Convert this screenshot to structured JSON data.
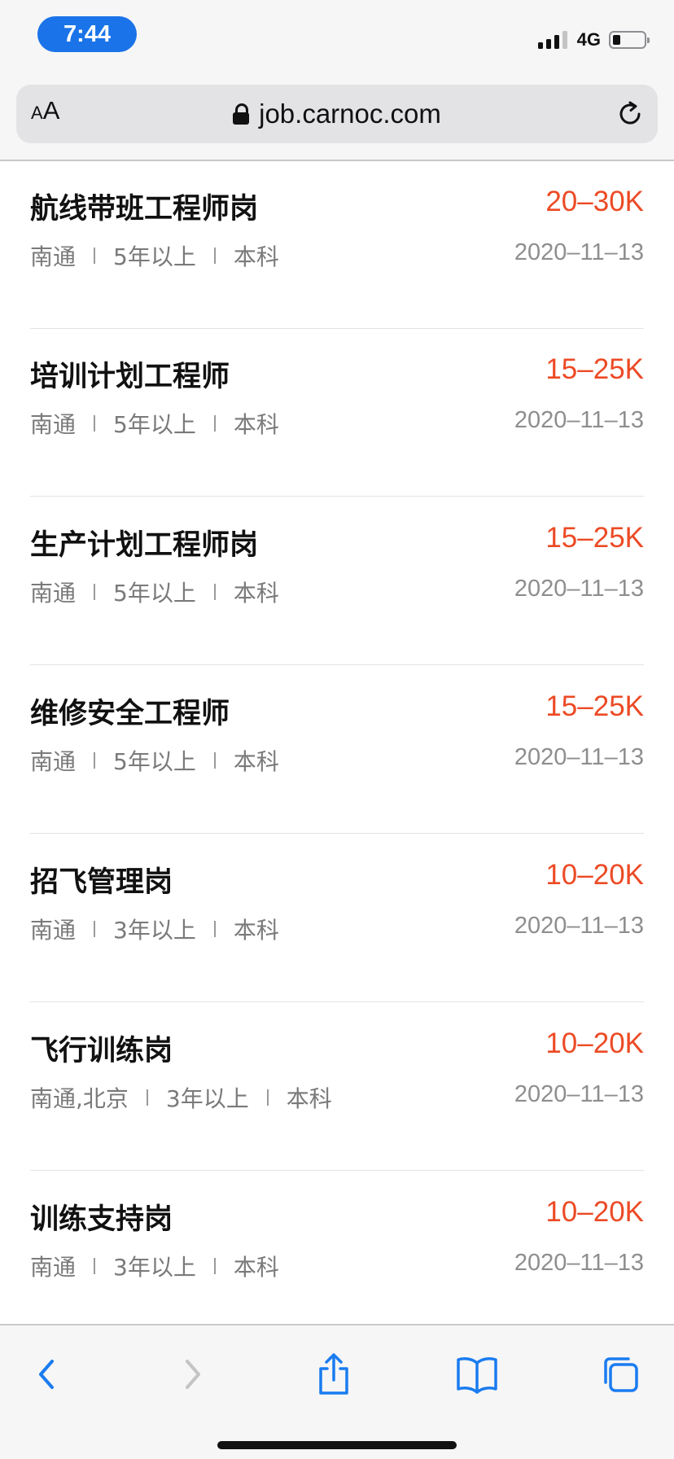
{
  "status_bar": {
    "time": "7:44",
    "network": "4G",
    "battery_level": 0.2
  },
  "address_bar": {
    "text_size_small": "A",
    "text_size_large": "A",
    "url": "job.carnoc.com"
  },
  "jobs": [
    {
      "title": "航线带班工程师岗",
      "salary": "20–30K",
      "location": "南通",
      "experience": "5年以上",
      "education": "本科",
      "date": "2020–11–13"
    },
    {
      "title": "培训计划工程师",
      "salary": "15–25K",
      "location": "南通",
      "experience": "5年以上",
      "education": "本科",
      "date": "2020–11–13"
    },
    {
      "title": "生产计划工程师岗",
      "salary": "15–25K",
      "location": "南通",
      "experience": "5年以上",
      "education": "本科",
      "date": "2020–11–13"
    },
    {
      "title": "维修安全工程师",
      "salary": "15–25K",
      "location": "南通",
      "experience": "5年以上",
      "education": "本科",
      "date": "2020–11–13"
    },
    {
      "title": "招飞管理岗",
      "salary": "10–20K",
      "location": "南通",
      "experience": "3年以上",
      "education": "本科",
      "date": "2020–11–13"
    },
    {
      "title": "飞行训练岗",
      "salary": "10–20K",
      "location": "南通,北京",
      "experience": "3年以上",
      "education": "本科",
      "date": "2020–11–13"
    },
    {
      "title": "训练支持岗",
      "salary": "10–20K",
      "location": "南通",
      "experience": "3年以上",
      "education": "本科",
      "date": "2020–11–13"
    }
  ],
  "toolbar": {
    "icons": [
      "back-icon",
      "forward-icon",
      "share-icon",
      "bookmarks-icon",
      "tabs-icon"
    ]
  },
  "colors": {
    "accent_blue": "#1a73e8",
    "salary_red": "#ec4a25",
    "toolbar_blue": "#1a7cf0",
    "toolbar_disabled": "#c4c4c4"
  }
}
